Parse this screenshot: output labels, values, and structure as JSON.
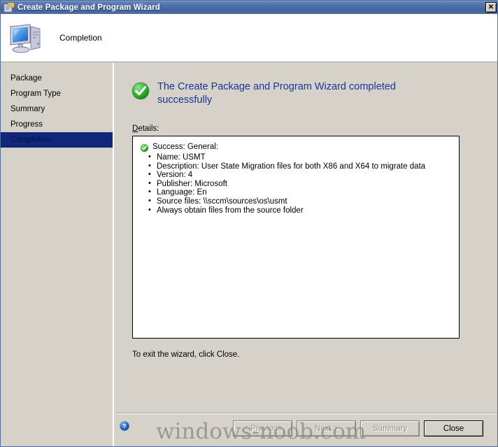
{
  "window": {
    "title": "Create Package and Program Wizard",
    "title_icon": "wizard-package-icon",
    "close_label": "✕"
  },
  "header": {
    "icon": "computer-icon",
    "step_title": "Completion"
  },
  "sidebar": {
    "items": [
      {
        "label": "Package",
        "active": false
      },
      {
        "label": "Program Type",
        "active": false
      },
      {
        "label": "Summary",
        "active": false
      },
      {
        "label": "Progress",
        "active": false
      },
      {
        "label": "Completion",
        "active": true
      }
    ]
  },
  "main": {
    "status_icon": "green-check-circle-icon",
    "heading": "The Create Package and Program Wizard completed successfully",
    "details_label": "Details:",
    "details": {
      "status_icon": "green-check-circle-icon",
      "status_text": "Success: General:",
      "bullets": [
        "Name: USMT",
        "Description: User State Migration files for both X86 and X64 to migrate data",
        "Version: 4",
        "Publisher: Microsoft",
        "Language: En",
        "Source files: \\\\sccm\\sources\\os\\usmt",
        "Always obtain files from the source folder"
      ]
    },
    "exit_note": "To exit the wizard, click Close."
  },
  "footer": {
    "help_icon": "help-circle-icon",
    "buttons": {
      "previous": "< Previous",
      "next": "Next >",
      "summary": "Summary",
      "close": "Close"
    }
  },
  "watermark": "windows-noob.com",
  "colors": {
    "titlebar_blue": "#4b6da8",
    "heading_blue": "#17359b",
    "sidebar_selected": "#12267c",
    "face": "#d6d2ca",
    "success_green": "#3ca63c"
  }
}
